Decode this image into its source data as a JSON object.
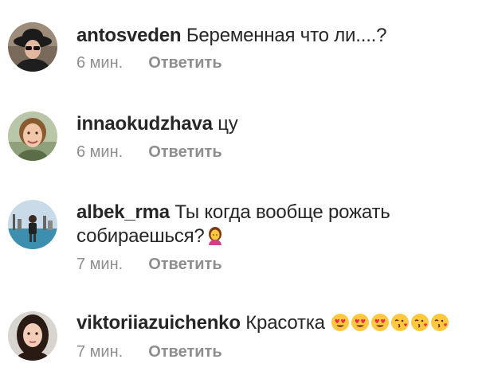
{
  "comments": [
    {
      "username": "antosveden",
      "text": "Беременная что ли....?",
      "time": "6 мин.",
      "reply_label": "Ответить",
      "avatar_icon": "user-avatar-hat-sunglasses"
    },
    {
      "username": "innaokudzhava",
      "text": "цу",
      "time": "6 мин.",
      "reply_label": "Ответить",
      "avatar_icon": "user-avatar-woman"
    },
    {
      "username": "albek_rma",
      "text": "Ты когда вообще рожать собираешься?",
      "time": "7 мин.",
      "reply_label": "Ответить",
      "avatar_icon": "user-avatar-city-skyline",
      "emojis": [
        "woman-raising-hand-emoji"
      ]
    },
    {
      "username": "viktoriiazuichenko",
      "text": "Красотка",
      "time": "7 мин.",
      "reply_label": "Ответить",
      "avatar_icon": "user-avatar-dark-hair-woman",
      "emojis": [
        "heart-eyes-emoji",
        "heart-eyes-emoji",
        "heart-eyes-emoji",
        "kissing-heart-emoji",
        "kissing-heart-emoji",
        "kissing-heart-emoji"
      ]
    }
  ],
  "colors": {
    "text": "#262626",
    "secondary": "#8e8e8e",
    "emoji_face": "#ffc83d",
    "heart": "#f0264d"
  }
}
